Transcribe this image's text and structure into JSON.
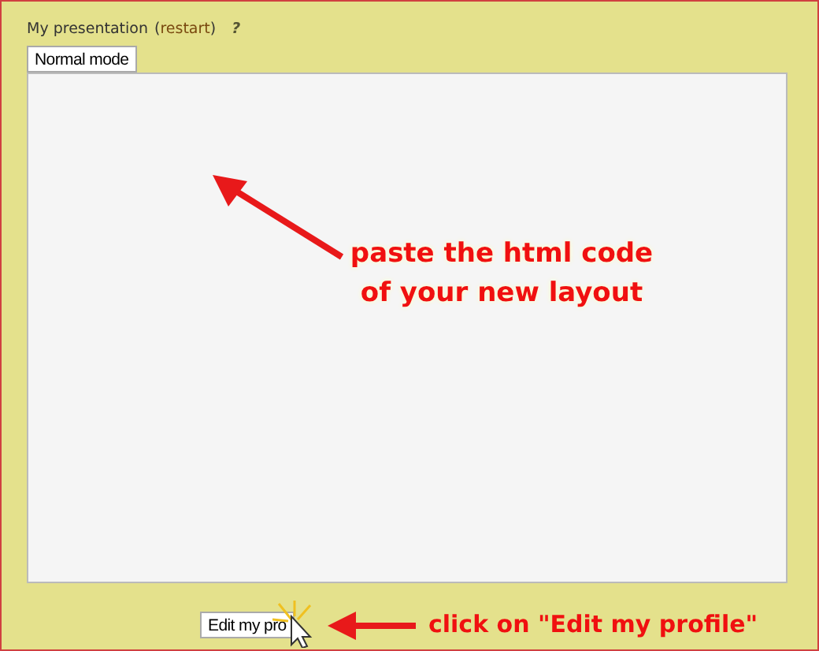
{
  "header": {
    "title": "My presentation",
    "open": "(",
    "link": "restart",
    "close": ")",
    "help": "?"
  },
  "mode_button": "Normal mode",
  "profile_button": "Edit my pro",
  "annotations": [
    {
      "kind": "arrow-text",
      "lines": [
        "paste the html code",
        "of your new layout"
      ]
    },
    {
      "kind": "arrow-text-bottom",
      "lines": [
        "click on \"Edit my profile\""
      ]
    }
  ]
}
